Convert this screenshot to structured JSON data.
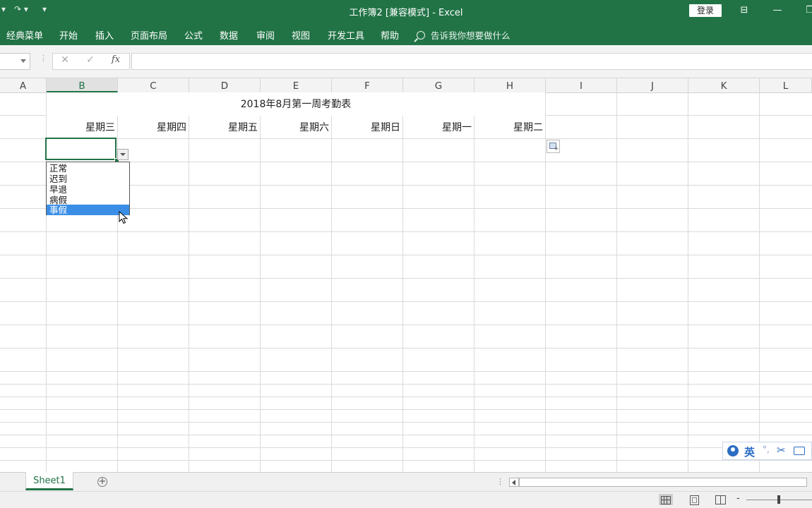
{
  "titlebar": {
    "window_title": "工作簿2  [兼容模式]  -  Excel",
    "login_label": "登录",
    "quick_access": {
      "undo": "▾",
      "redo": "↷ ▾",
      "customize": "▾"
    },
    "controls": {
      "ribbon_display": "⊟",
      "minimize": "—",
      "restore": "❐"
    }
  },
  "ribbon": {
    "tabs": [
      "经典菜单",
      "开始",
      "插入",
      "页面布局",
      "公式",
      "数据",
      "审阅",
      "视图",
      "开发工具",
      "帮助"
    ],
    "tell_me": "告诉我你想要做什么"
  },
  "formula_bar": {
    "name_box": "",
    "cancel": "✕",
    "enter": "✓",
    "fx": "fx",
    "formula": ""
  },
  "columns": [
    "A",
    "B",
    "C",
    "D",
    "E",
    "F",
    "G",
    "H",
    "I",
    "J",
    "K",
    "L"
  ],
  "selected_column": "B",
  "sheet": {
    "title": "2018年8月第一周考勤表",
    "days": [
      "星期三",
      "星期四",
      "星期五",
      "星期六",
      "星期日",
      "星期一",
      "星期二"
    ]
  },
  "dropdown": {
    "options": [
      "正常",
      "迟到",
      "早退",
      "病假",
      "事假"
    ],
    "highlighted": "事假"
  },
  "ime": {
    "language": "英",
    "punct": "°,"
  },
  "sheet_tabs": {
    "tabs": [
      "Sheet1"
    ],
    "active": "Sheet1",
    "add_label": "+"
  },
  "tab_bar": {
    "dots": "⋮"
  },
  "statusbar": {
    "zoom_minus": "-"
  }
}
